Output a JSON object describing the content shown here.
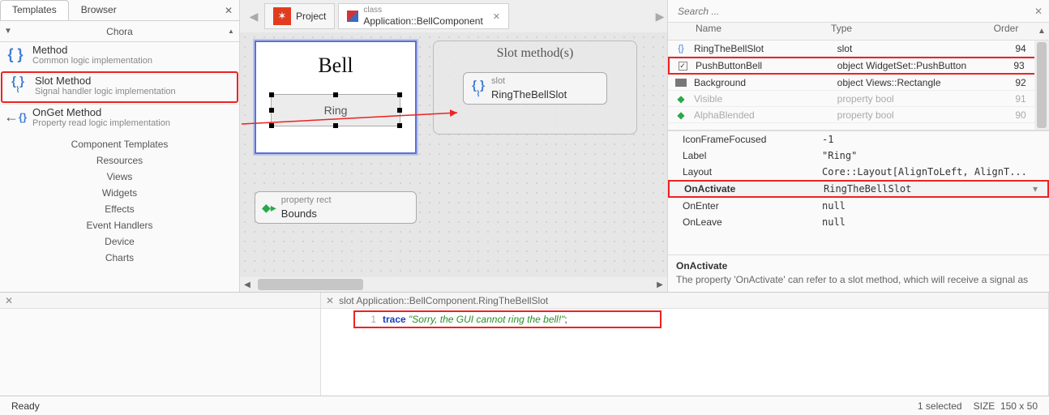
{
  "left": {
    "tabs": {
      "templates": "Templates",
      "browser": "Browser"
    },
    "group_title": "Chora",
    "items": [
      {
        "title": "Method",
        "desc": "Common logic implementation"
      },
      {
        "title": "Slot Method",
        "desc": "Signal handler logic implementation"
      },
      {
        "title": "OnGet Method",
        "desc": "Property read logic implementation"
      }
    ],
    "categories": [
      "Component Templates",
      "Resources",
      "Views",
      "Widgets",
      "Effects",
      "Event Handlers",
      "Device",
      "Charts"
    ]
  },
  "mid": {
    "project_tab": "Project",
    "class_tab_sup": "class",
    "class_tab_name": "Application::BellComponent",
    "bell_title": "Bell",
    "ring_label": "Ring",
    "slot_group_title": "Slot method(s)",
    "slot_chip_sup": "slot",
    "slot_chip_name": "RingTheBellSlot",
    "prop_chip_sup": "property rect",
    "prop_chip_name": "Bounds"
  },
  "search": {
    "placeholder": "Search ..."
  },
  "members": {
    "headers": {
      "name": "Name",
      "type": "Type",
      "order": "Order"
    },
    "rows": [
      {
        "name": "RingTheBellSlot",
        "type": "slot",
        "order": "94",
        "dim": false,
        "icon": "slot"
      },
      {
        "name": "PushButtonBell",
        "type": "object WidgetSet::PushButton",
        "order": "93",
        "dim": false,
        "icon": "check",
        "hl": true
      },
      {
        "name": "Background",
        "type": "object Views::Rectangle",
        "order": "92",
        "dim": false,
        "icon": "rect"
      },
      {
        "name": "Visible",
        "type": "property bool",
        "order": "91",
        "dim": true,
        "icon": "prop"
      },
      {
        "name": "AlphaBlended",
        "type": "property bool",
        "order": "90",
        "dim": true,
        "icon": "prop"
      }
    ]
  },
  "props": [
    {
      "name": "IconFrameFocused",
      "value": "-1"
    },
    {
      "name": "Label",
      "value": "\"Ring\""
    },
    {
      "name": "Layout",
      "value": "Core::Layout[AlignToLeft, AlignT..."
    },
    {
      "name": "OnActivate",
      "value": "RingTheBellSlot",
      "hl": true
    },
    {
      "name": "OnEnter",
      "value": "null"
    },
    {
      "name": "OnLeave",
      "value": "null"
    }
  ],
  "desc": {
    "title": "OnActivate",
    "body": "The property 'OnActivate' can refer to a slot method, which will receive a signal as"
  },
  "code": {
    "header": "slot Application::BellComponent.RingTheBellSlot",
    "line_no": "1",
    "kw": "trace",
    "str": "\"Sorry, the GUI cannot ring the bell!\"",
    "semi": ";"
  },
  "status": {
    "ready": "Ready",
    "selected": "1 selected",
    "size_label": "SIZE",
    "size_value": "150 x 50"
  }
}
